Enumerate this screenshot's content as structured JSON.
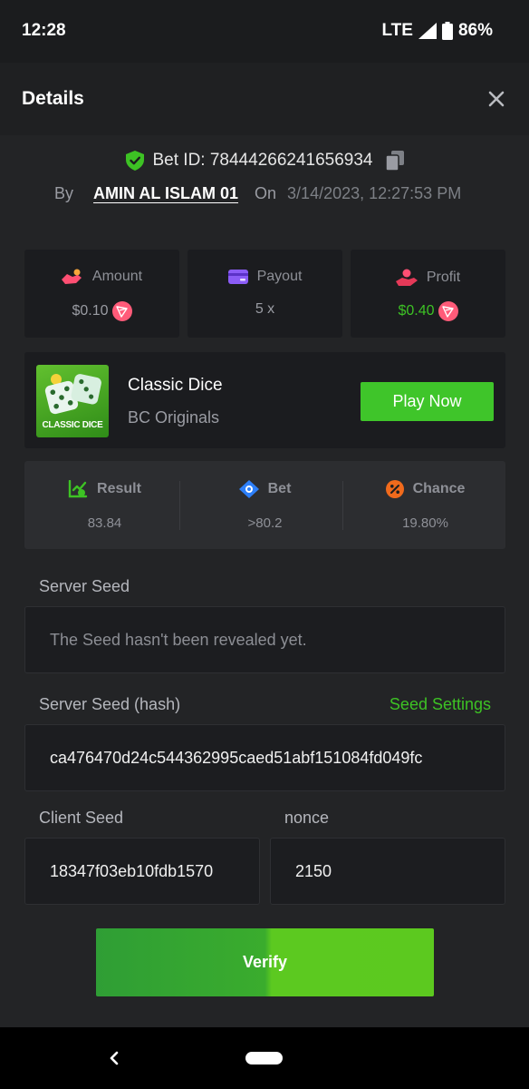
{
  "status_bar": {
    "time": "12:28",
    "network": "LTE",
    "battery": "86%"
  },
  "header": {
    "title": "Details"
  },
  "bet": {
    "id_label": "Bet ID: 78444266241656934",
    "by_label": "By",
    "username": "AMIN AL ISLAM 01",
    "on_label": "On",
    "datetime": "3/14/2023, 12:27:53 PM"
  },
  "stats": {
    "amount": {
      "label": "Amount",
      "value": "$0.10"
    },
    "payout": {
      "label": "Payout",
      "value": "5 x"
    },
    "profit": {
      "label": "Profit",
      "value": "$0.40"
    }
  },
  "game": {
    "name": "Classic Dice",
    "provider": "BC Originals",
    "thumb_label": "CLASSIC DICE",
    "play_label": "Play Now"
  },
  "result": {
    "result": {
      "label": "Result",
      "value": "83.84"
    },
    "bet": {
      "label": "Bet",
      "value": ">80.2"
    },
    "chance": {
      "label": "Chance",
      "value": "19.80%"
    }
  },
  "seeds": {
    "server_seed_label": "Server Seed",
    "server_seed_value": "The Seed hasn't been revealed yet.",
    "server_hash_label": "Server Seed (hash)",
    "seed_settings_label": "Seed Settings",
    "server_hash_value": "ca476470d24c544362995caed51abf151084fd049fc",
    "client_seed_label": "Client Seed",
    "client_seed_value": "18347f03eb10fdb1570",
    "nonce_label": "nonce",
    "nonce_value": "2150"
  },
  "verify_label": "Verify",
  "colors": {
    "accent_green": "#3fc52a",
    "coin_pink": "#ff5b79",
    "background": "#232426"
  }
}
